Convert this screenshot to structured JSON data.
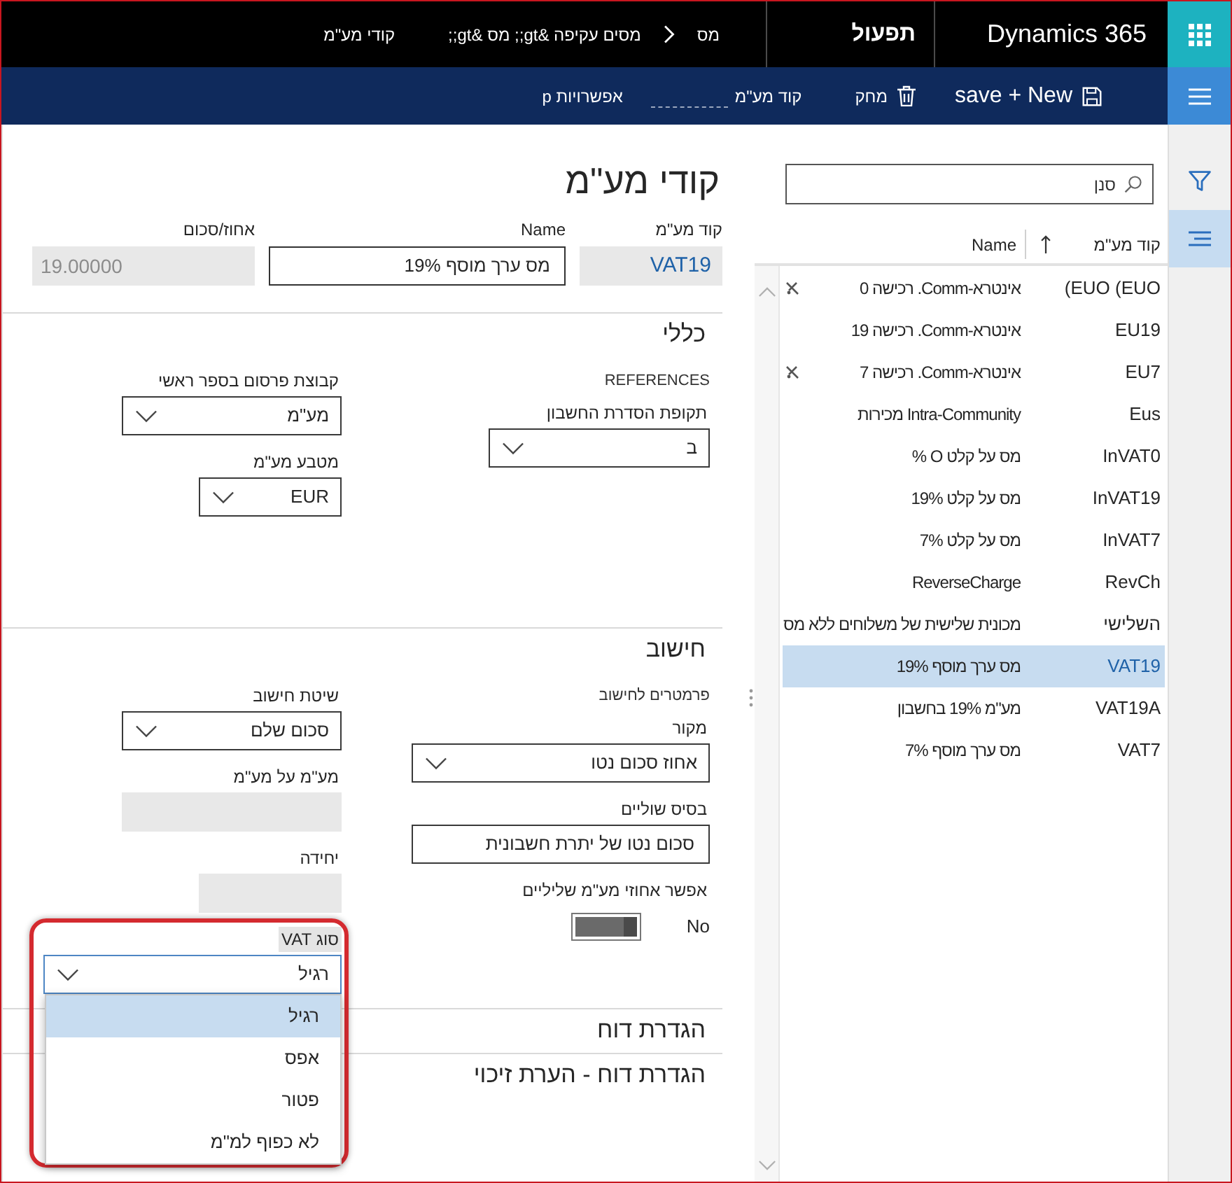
{
  "top_bar": {
    "app_name": "Dynamics 365",
    "module": "תפעול",
    "breadcrumb": [
      {
        "kind": "link",
        "text": "מס"
      },
      {
        "kind": "chevron"
      },
      {
        "kind": "link",
        "text": "מסים עקיפה &gt;; מס &gt;;"
      },
      {
        "kind": "link",
        "text": "קודי מע\"מ"
      }
    ]
  },
  "action_bar": {
    "actions": [
      {
        "kind": "save_new",
        "label": "save + New"
      },
      {
        "kind": "delete",
        "label": "מחק"
      },
      {
        "kind": "text",
        "label": "קוד מע\"מ"
      },
      {
        "kind": "text",
        "label": "אפשרויות p"
      }
    ]
  },
  "side_nav": {
    "items": [
      {
        "kind": "filter",
        "selected": false
      },
      {
        "kind": "list",
        "selected": true
      }
    ]
  },
  "list": {
    "search": {
      "placeholder": "סנן"
    },
    "columns": [
      {
        "label": "קוד מע\"מ",
        "sorted": true
      },
      {
        "label": "Name",
        "sorted": false
      }
    ],
    "rows": [
      {
        "code": "(EUO (EUO",
        "name": "אינטרא-Comm. רכישה 0",
        "selected": false,
        "flagged": true
      },
      {
        "code": "EU19",
        "name": "אינטרא-Comm. רכישה 19",
        "selected": false,
        "flagged": false
      },
      {
        "code": "EU7",
        "name": "אינטרא-Comm. רכישה 7",
        "selected": false,
        "flagged": true
      },
      {
        "code": "Eus",
        "name": "Intra-Community מכירות",
        "selected": false,
        "flagged": false
      },
      {
        "code": "InVAT0",
        "name": "מס על קלט O %",
        "selected": false,
        "flagged": false
      },
      {
        "code": "InVAT19",
        "name": "מס על קלט 19%",
        "selected": false,
        "flagged": false
      },
      {
        "code": "InVAT7",
        "name": "מס על קלט 7%",
        "selected": false,
        "flagged": false
      },
      {
        "code": "RevCh",
        "name": "ReverseCharge",
        "selected": false,
        "flagged": false
      },
      {
        "code": "השלישי",
        "name": "מכונית שלישית של משלוחים ללא מס",
        "selected": false,
        "flagged": false
      },
      {
        "code": "VAT19",
        "name": "מס ערך מוסף 19%",
        "selected": true,
        "flagged": false
      },
      {
        "code": "VAT19A",
        "name": "מע\"מ 19% בחשבון",
        "selected": false,
        "flagged": false
      },
      {
        "code": "VAT7",
        "name": "מס ערך מוסף 7%",
        "selected": false,
        "flagged": false
      }
    ]
  },
  "form": {
    "title": "קודי מע\"מ",
    "header_fields": [
      {
        "kind": "code",
        "label": "קוד מע\"מ",
        "value": "VAT19"
      },
      {
        "kind": "text",
        "label": "Name",
        "value": "מס ערך מוסף 19%"
      },
      {
        "kind": "readonly",
        "label": "אחוז/סכום",
        "value": "19.00000"
      }
    ],
    "sections": [
      {
        "title": "כללי",
        "columns": [
          [
            {
              "kind": "group",
              "label": "REFERENCES"
            },
            {
              "kind": "dropdown",
              "label": "תקופת הסדרת החשבון",
              "value": "ב",
              "expanded": false
            }
          ],
          [
            {
              "kind": "dropdown",
              "label": "קבוצת פרסום בספר ראשי",
              "value": "מע\"מ",
              "expanded": false
            },
            {
              "kind": "dropdown",
              "label": "מטבע מע\"מ",
              "value": "EUR",
              "expanded": false
            }
          ]
        ]
      },
      {
        "title": "חישוב",
        "columns": [
          [
            {
              "kind": "group",
              "label": "פרמטרים לחישוב"
            },
            {
              "kind": "dropdown",
              "label": "מקור",
              "value": "אחוז סכום נטו",
              "expanded": false
            },
            {
              "kind": "text",
              "label": "בסיס שוליים",
              "value": "סכום נטו של יתרת חשבונית"
            },
            {
              "kind": "toggle",
              "label": "אפשר אחוזי מע\"מ שליליים",
              "value": "No",
              "on": false
            }
          ],
          [
            {
              "kind": "dropdown",
              "label": "שיטת חישוב",
              "value": "סכום שלם",
              "expanded": false
            },
            {
              "kind": "readonly",
              "label": "מע\"מ על מע\"מ"
            },
            {
              "kind": "readonly",
              "label": "יחידה"
            },
            {
              "kind": "dropdown",
              "label": "סוג VAT",
              "value": "רגיל",
              "expanded": true,
              "highlighted": true,
              "options": [
                {
                  "label": "רגיל",
                  "selected": true
                },
                {
                  "label": "אפס",
                  "selected": false
                },
                {
                  "label": "פטור",
                  "selected": false
                },
                {
                  "label": "לא כפוף למ\"מ",
                  "selected": false
                }
              ]
            }
          ]
        ]
      },
      {
        "title": "הגדרת דוח"
      },
      {
        "title": "הגדרת דוח - הערת זיכוי"
      }
    ]
  }
}
